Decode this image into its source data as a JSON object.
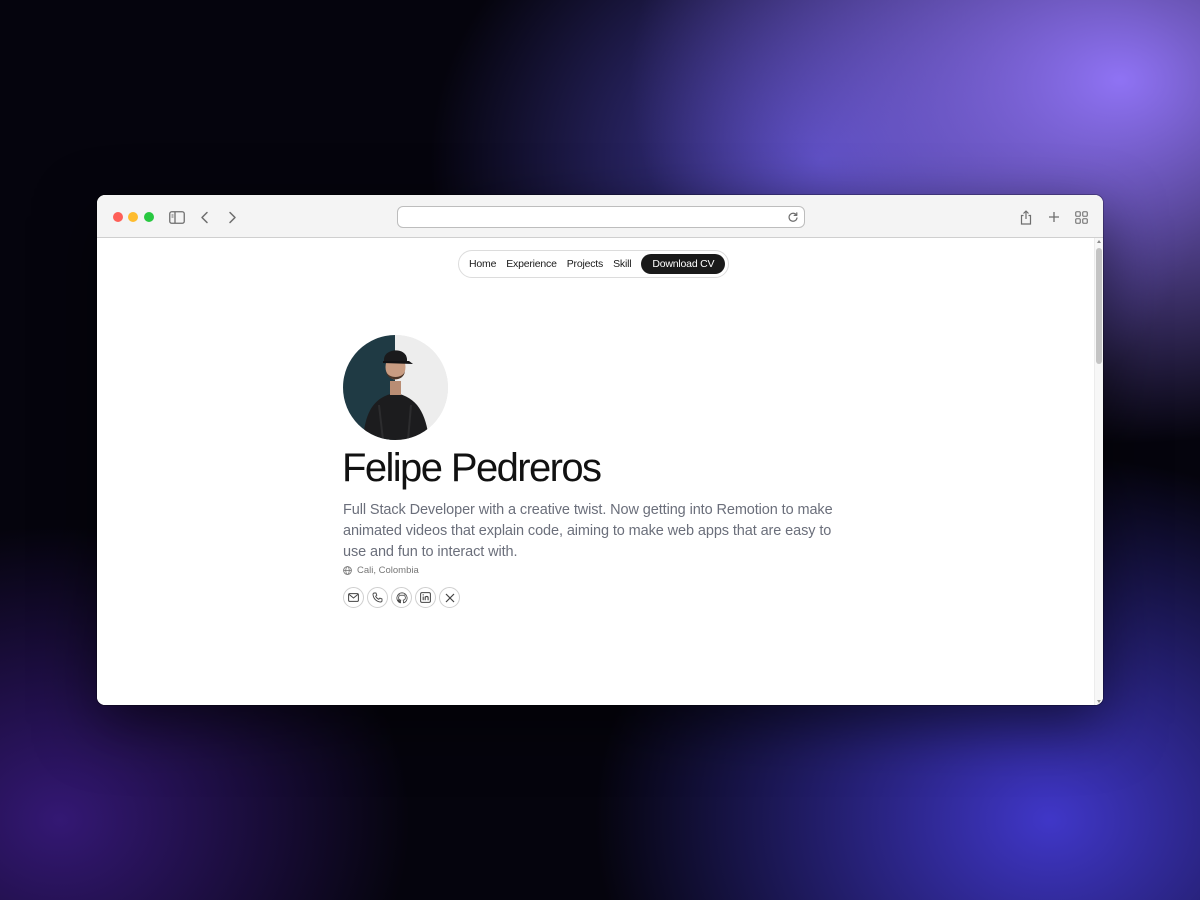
{
  "browser": {
    "url_value": "",
    "icons": [
      "sidebar-icon",
      "back-icon",
      "forward-icon",
      "reload-icon",
      "share-icon",
      "new-tab-icon",
      "tab-overview-icon"
    ]
  },
  "nav": {
    "items": [
      "Home",
      "Experience",
      "Projects",
      "Skill"
    ],
    "cta": "Download CV"
  },
  "profile": {
    "name": "Felipe Pedreros",
    "bio": "Full Stack Developer with a creative twist. Now getting into Remotion to make animated videos that explain code, aiming to make web apps that are easy to use and fun to interact with.",
    "location": "Cali, Colombia",
    "socials": [
      "mail-icon",
      "phone-icon",
      "github-icon",
      "linkedin-icon",
      "x-icon"
    ]
  },
  "colors": {
    "cta_bg": "#1a1a1a",
    "text_primary": "#111111",
    "text_secondary": "#6b6f7b"
  }
}
